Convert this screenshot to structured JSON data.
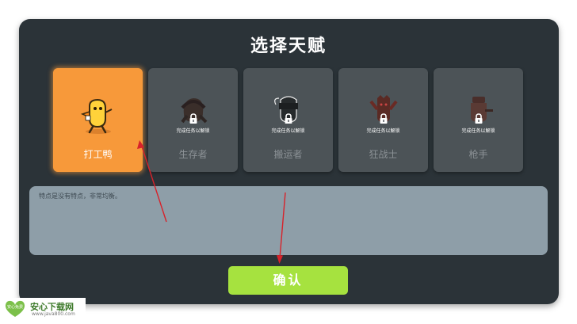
{
  "screen": {
    "title": "选择天赋"
  },
  "talents": [
    {
      "label": "打工鸭",
      "selected": true,
      "locked": false,
      "icon": "duck-character-icon"
    },
    {
      "label": "生存者",
      "selected": false,
      "locked": true,
      "lock_text": "完成任务以解锁",
      "icon": "survivor-silhouette-icon"
    },
    {
      "label": "搬运者",
      "selected": false,
      "locked": true,
      "lock_text": "完成任务以解锁",
      "icon": "porter-silhouette-icon"
    },
    {
      "label": "狂战士",
      "selected": false,
      "locked": true,
      "lock_text": "完成任务以解锁",
      "icon": "berserker-silhouette-icon"
    },
    {
      "label": "枪手",
      "selected": false,
      "locked": true,
      "lock_text": "完成任务以解锁",
      "icon": "gunner-silhouette-icon"
    }
  ],
  "description": {
    "text": "特点是没有特点，非常均衡。"
  },
  "confirm_button": {
    "label": "确认"
  },
  "watermark": {
    "logo_text": "安心免费",
    "name": "安心下载网",
    "url": "www.java800.com"
  },
  "colors": {
    "panel_bg": "#2b3338",
    "card_bg": "#4c5357",
    "selected_card": "#f7993a",
    "description_bg": "#8e9ea8",
    "confirm_button": "#a6e23f",
    "annotation_arrow": "#d8222a"
  }
}
